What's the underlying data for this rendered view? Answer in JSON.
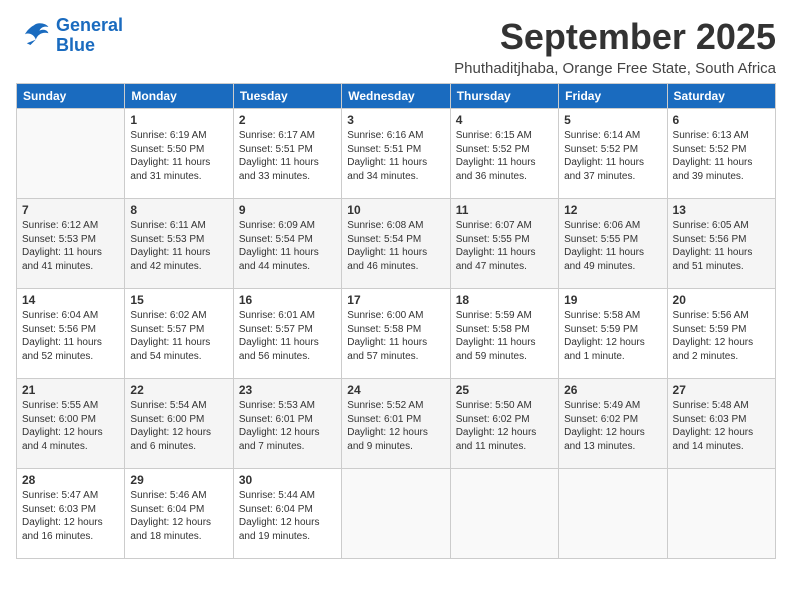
{
  "logo": {
    "line1": "General",
    "line2": "Blue"
  },
  "title": "September 2025",
  "location": "Phuthaditjhaba, Orange Free State, South Africa",
  "headers": [
    "Sunday",
    "Monday",
    "Tuesday",
    "Wednesday",
    "Thursday",
    "Friday",
    "Saturday"
  ],
  "weeks": [
    [
      {
        "day": "",
        "info": ""
      },
      {
        "day": "1",
        "info": "Sunrise: 6:19 AM\nSunset: 5:50 PM\nDaylight: 11 hours\nand 31 minutes."
      },
      {
        "day": "2",
        "info": "Sunrise: 6:17 AM\nSunset: 5:51 PM\nDaylight: 11 hours\nand 33 minutes."
      },
      {
        "day": "3",
        "info": "Sunrise: 6:16 AM\nSunset: 5:51 PM\nDaylight: 11 hours\nand 34 minutes."
      },
      {
        "day": "4",
        "info": "Sunrise: 6:15 AM\nSunset: 5:52 PM\nDaylight: 11 hours\nand 36 minutes."
      },
      {
        "day": "5",
        "info": "Sunrise: 6:14 AM\nSunset: 5:52 PM\nDaylight: 11 hours\nand 37 minutes."
      },
      {
        "day": "6",
        "info": "Sunrise: 6:13 AM\nSunset: 5:52 PM\nDaylight: 11 hours\nand 39 minutes."
      }
    ],
    [
      {
        "day": "7",
        "info": "Sunrise: 6:12 AM\nSunset: 5:53 PM\nDaylight: 11 hours\nand 41 minutes."
      },
      {
        "day": "8",
        "info": "Sunrise: 6:11 AM\nSunset: 5:53 PM\nDaylight: 11 hours\nand 42 minutes."
      },
      {
        "day": "9",
        "info": "Sunrise: 6:09 AM\nSunset: 5:54 PM\nDaylight: 11 hours\nand 44 minutes."
      },
      {
        "day": "10",
        "info": "Sunrise: 6:08 AM\nSunset: 5:54 PM\nDaylight: 11 hours\nand 46 minutes."
      },
      {
        "day": "11",
        "info": "Sunrise: 6:07 AM\nSunset: 5:55 PM\nDaylight: 11 hours\nand 47 minutes."
      },
      {
        "day": "12",
        "info": "Sunrise: 6:06 AM\nSunset: 5:55 PM\nDaylight: 11 hours\nand 49 minutes."
      },
      {
        "day": "13",
        "info": "Sunrise: 6:05 AM\nSunset: 5:56 PM\nDaylight: 11 hours\nand 51 minutes."
      }
    ],
    [
      {
        "day": "14",
        "info": "Sunrise: 6:04 AM\nSunset: 5:56 PM\nDaylight: 11 hours\nand 52 minutes."
      },
      {
        "day": "15",
        "info": "Sunrise: 6:02 AM\nSunset: 5:57 PM\nDaylight: 11 hours\nand 54 minutes."
      },
      {
        "day": "16",
        "info": "Sunrise: 6:01 AM\nSunset: 5:57 PM\nDaylight: 11 hours\nand 56 minutes."
      },
      {
        "day": "17",
        "info": "Sunrise: 6:00 AM\nSunset: 5:58 PM\nDaylight: 11 hours\nand 57 minutes."
      },
      {
        "day": "18",
        "info": "Sunrise: 5:59 AM\nSunset: 5:58 PM\nDaylight: 11 hours\nand 59 minutes."
      },
      {
        "day": "19",
        "info": "Sunrise: 5:58 AM\nSunset: 5:59 PM\nDaylight: 12 hours\nand 1 minute."
      },
      {
        "day": "20",
        "info": "Sunrise: 5:56 AM\nSunset: 5:59 PM\nDaylight: 12 hours\nand 2 minutes."
      }
    ],
    [
      {
        "day": "21",
        "info": "Sunrise: 5:55 AM\nSunset: 6:00 PM\nDaylight: 12 hours\nand 4 minutes."
      },
      {
        "day": "22",
        "info": "Sunrise: 5:54 AM\nSunset: 6:00 PM\nDaylight: 12 hours\nand 6 minutes."
      },
      {
        "day": "23",
        "info": "Sunrise: 5:53 AM\nSunset: 6:01 PM\nDaylight: 12 hours\nand 7 minutes."
      },
      {
        "day": "24",
        "info": "Sunrise: 5:52 AM\nSunset: 6:01 PM\nDaylight: 12 hours\nand 9 minutes."
      },
      {
        "day": "25",
        "info": "Sunrise: 5:50 AM\nSunset: 6:02 PM\nDaylight: 12 hours\nand 11 minutes."
      },
      {
        "day": "26",
        "info": "Sunrise: 5:49 AM\nSunset: 6:02 PM\nDaylight: 12 hours\nand 13 minutes."
      },
      {
        "day": "27",
        "info": "Sunrise: 5:48 AM\nSunset: 6:03 PM\nDaylight: 12 hours\nand 14 minutes."
      }
    ],
    [
      {
        "day": "28",
        "info": "Sunrise: 5:47 AM\nSunset: 6:03 PM\nDaylight: 12 hours\nand 16 minutes."
      },
      {
        "day": "29",
        "info": "Sunrise: 5:46 AM\nSunset: 6:04 PM\nDaylight: 12 hours\nand 18 minutes."
      },
      {
        "day": "30",
        "info": "Sunrise: 5:44 AM\nSunset: 6:04 PM\nDaylight: 12 hours\nand 19 minutes."
      },
      {
        "day": "",
        "info": ""
      },
      {
        "day": "",
        "info": ""
      },
      {
        "day": "",
        "info": ""
      },
      {
        "day": "",
        "info": ""
      }
    ]
  ]
}
